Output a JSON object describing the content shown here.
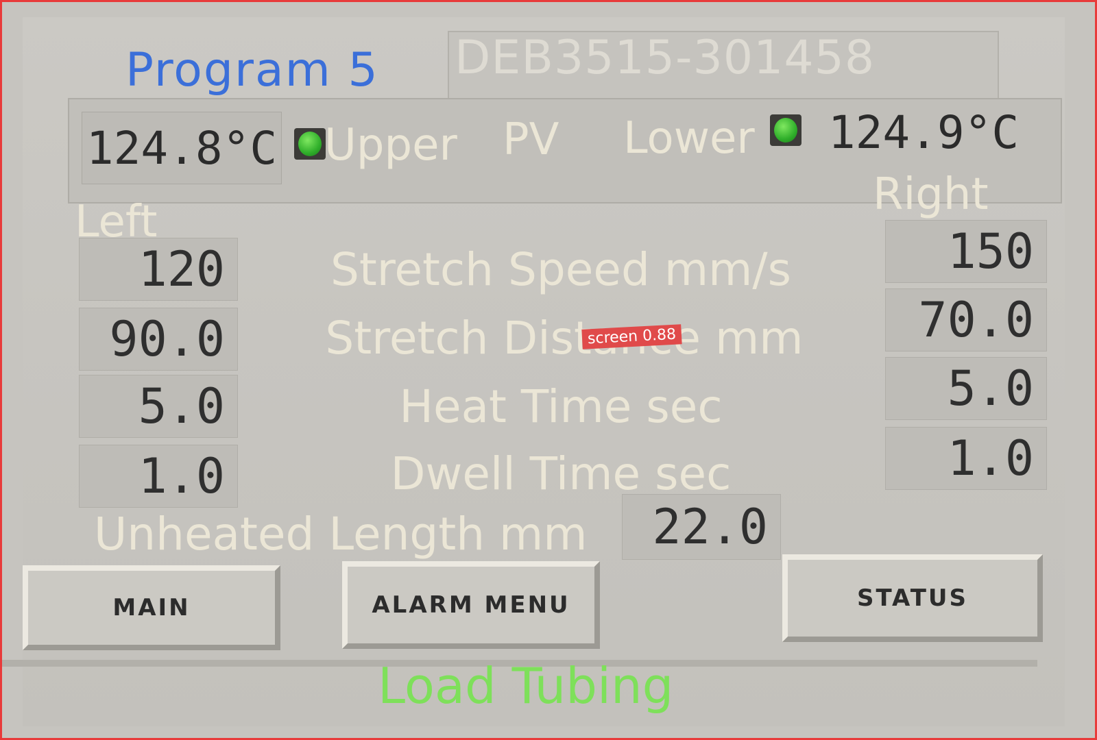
{
  "header": {
    "program_label": "Program 5",
    "part_number": "DEB3515-301458"
  },
  "pv_bar": {
    "upper_temp": "124.8°C",
    "upper_label": "Upper",
    "pv_label": "PV",
    "lower_label": "Lower",
    "lower_temp": "124.9°C",
    "lamp_color": "#2fae2a"
  },
  "columns": {
    "left_label": "Left",
    "right_label": "Right"
  },
  "params": [
    {
      "label": "Stretch Speed mm/s",
      "left": "120",
      "right": "150"
    },
    {
      "label": "Stretch Distance mm",
      "left": "90.0",
      "right": "70.0"
    },
    {
      "label": "Heat Time sec",
      "left": "5.0",
      "right": "5.0"
    },
    {
      "label": "Dwell Time sec",
      "left": "1.0",
      "right": "1.0"
    }
  ],
  "unheated": {
    "label": "Unheated Length mm",
    "value": "22.0"
  },
  "buttons": {
    "main": "MAIN",
    "alarm_menu": "ALARM MENU",
    "status": "STATUS"
  },
  "status_message": "Load Tubing",
  "overlay": {
    "detection_label": "screen 0.88"
  }
}
